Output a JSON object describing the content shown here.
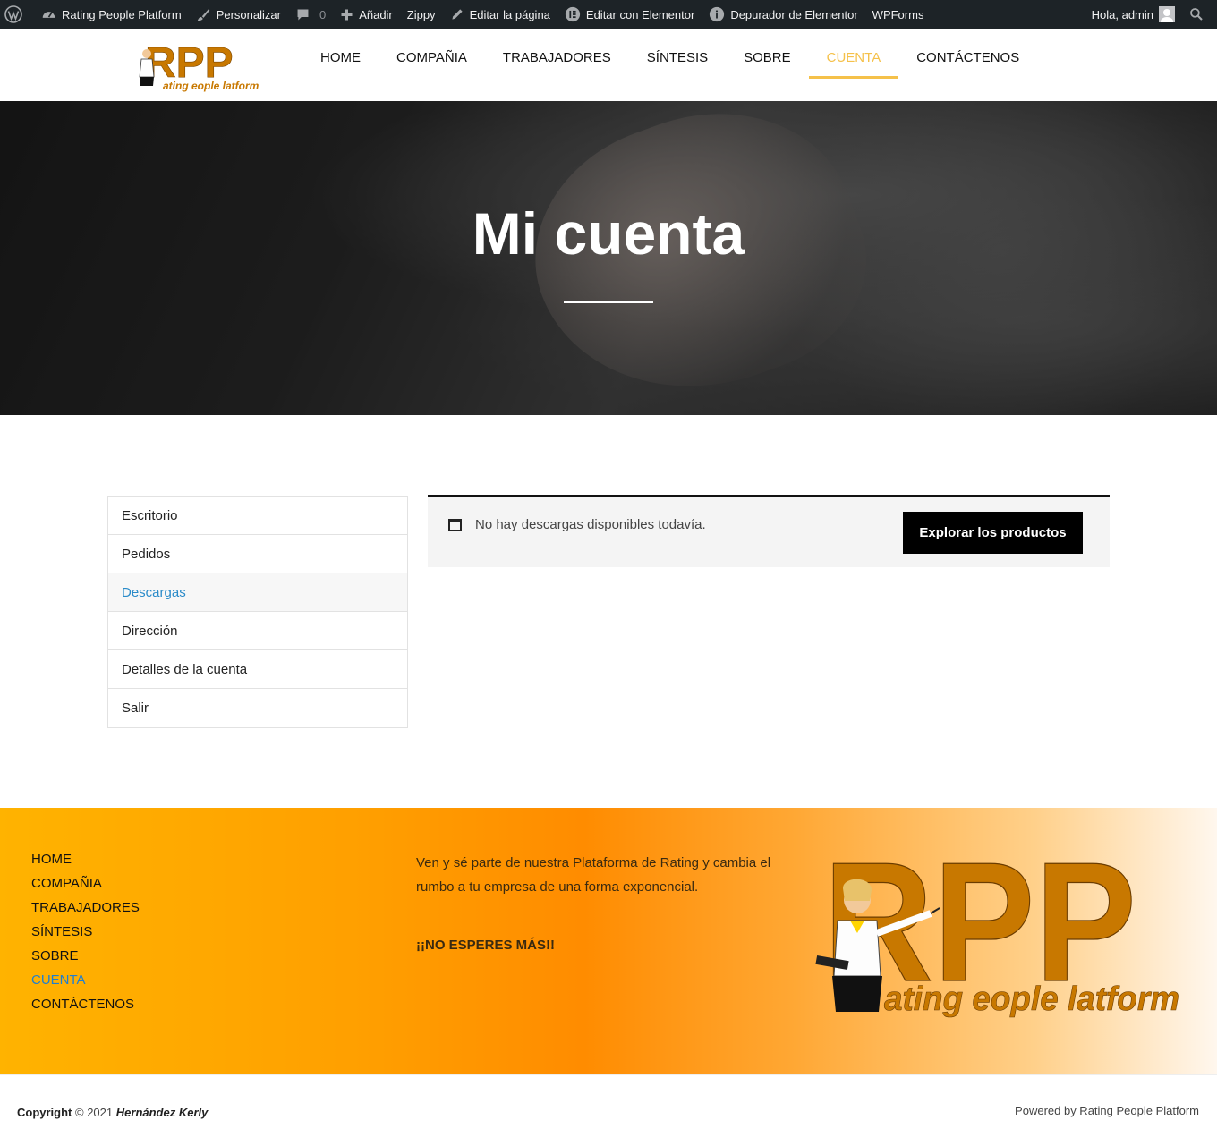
{
  "adminbar": {
    "site_name": "Rating People Platform",
    "customize": "Personalizar",
    "comments_count": "0",
    "add_new": "Añadir",
    "zippy": "Zippy",
    "edit_page": "Editar la página",
    "edit_elementor": "Editar con Elementor",
    "elementor_debugger": "Depurador de Elementor",
    "wpforms": "WPForms",
    "greeting": "Hola, admin"
  },
  "nav": {
    "items": [
      "HOME",
      "COMPAÑIA",
      "TRABAJADORES",
      "SÍNTESIS",
      "SOBRE",
      "CUENTA",
      "CONTÁCTENOS"
    ],
    "active": "CUENTA"
  },
  "logo": {
    "letters": "RPP",
    "tagline": "ating eople latform"
  },
  "hero": {
    "title": "Mi cuenta"
  },
  "account": {
    "menu": [
      "Escritorio",
      "Pedidos",
      "Descargas",
      "Dirección",
      "Detalles de la cuenta",
      "Salir"
    ],
    "active": "Descargas",
    "notice_text": "No hay descargas disponibles todavía.",
    "notice_button": "Explorar los productos"
  },
  "footer": {
    "nav": [
      "HOME",
      "COMPAÑIA",
      "TRABAJADORES",
      "SÍNTESIS",
      "SOBRE",
      "CUENTA",
      "CONTÁCTENOS"
    ],
    "active": "CUENTA",
    "text": "Ven y sé parte de nuestra Plataforma de Rating y cambia el rumbo a tu empresa de una forma exponencial.",
    "cta": "¡¡NO ESPERES MÁS!!",
    "copyright_label": "Copyright",
    "copyright_year": "© 2021",
    "copyright_author": "Hernández Kerly",
    "powered": "Powered by Rating People Platform"
  },
  "colors": {
    "accent": "#f5c14a",
    "link": "#2a8bc9",
    "logo_brown": "#c87800"
  }
}
